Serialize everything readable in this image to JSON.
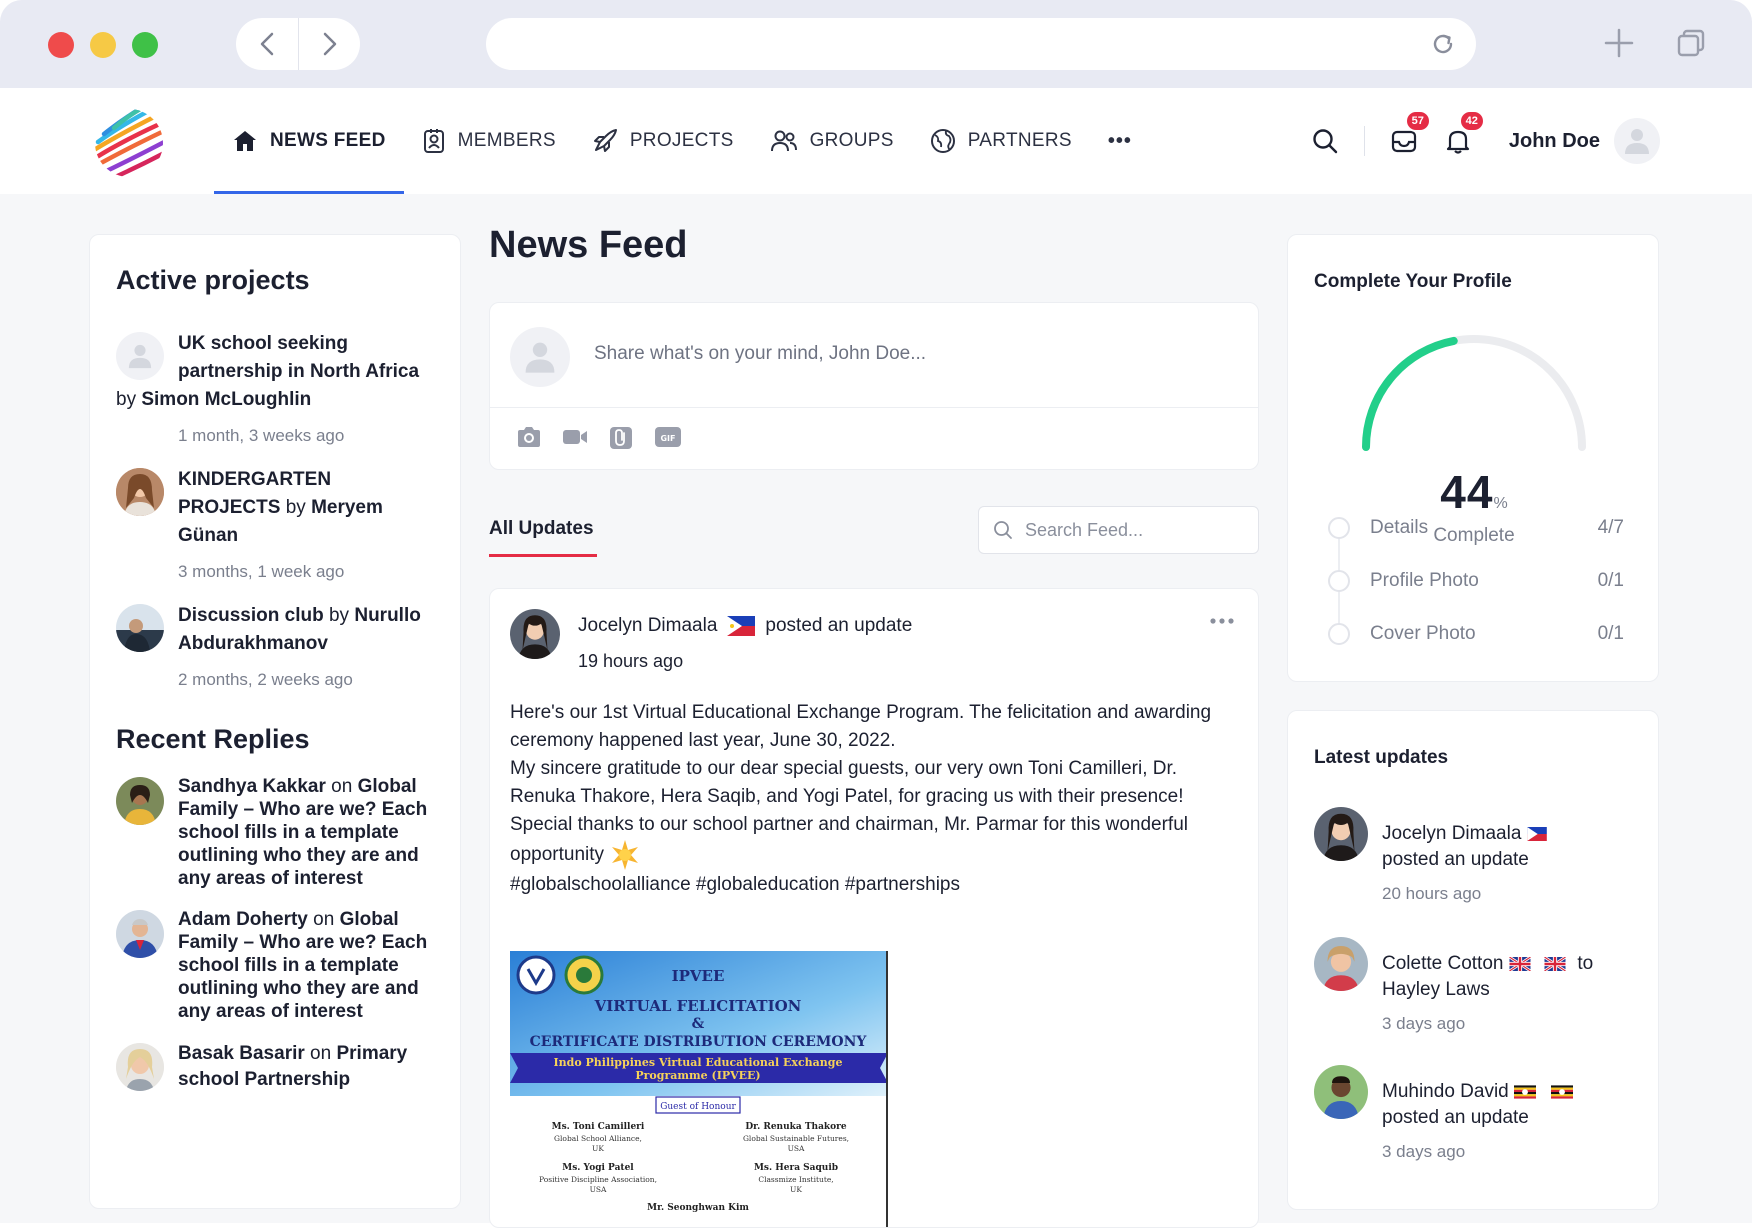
{
  "header": {
    "nav": [
      {
        "label": "NEWS FEED",
        "icon": "home-icon",
        "active": true
      },
      {
        "label": "MEMBERS",
        "icon": "members-icon"
      },
      {
        "label": "PROJECTS",
        "icon": "projects-icon"
      },
      {
        "label": "GROUPS",
        "icon": "groups-icon"
      },
      {
        "label": "PARTNERS",
        "icon": "partners-icon"
      }
    ],
    "more_label": "•••",
    "inbox_count": "57",
    "notifications_count": "42",
    "user_name": "John Doe"
  },
  "left": {
    "active_title": "Active projects",
    "projects": [
      {
        "title": "UK school seeking partnership in North Africa",
        "by": "by",
        "author": "Simon McLoughlin",
        "time": "1 month, 3 weeks ago"
      },
      {
        "title": "KINDERGARTEN PROJECTS",
        "by": "by",
        "author": "Meryem Günan",
        "time": "3 months, 1 week ago"
      },
      {
        "title": "Discussion club",
        "by": "by",
        "author": "Nurullo Abdurakhmanov",
        "time": "2 months, 2 weeks ago"
      }
    ],
    "replies_title": "Recent Replies",
    "replies": [
      {
        "author": "Sandhya Kakkar",
        "on": "on",
        "topic": "Global Family – Who are we? Each school fills in a template outlining who they are and any areas of interest"
      },
      {
        "author": "Adam Doherty",
        "on": "on",
        "topic": "Global Family – Who are we? Each school fills in a template outlining who they are and any areas of interest"
      },
      {
        "author": "Basak Basarir",
        "on": "on",
        "topic": "Primary school Partnership"
      }
    ]
  },
  "center": {
    "title": "News Feed",
    "composer_placeholder": "Share what's on your mind, John Doe...",
    "tab_all": "All Updates",
    "search_placeholder": "Search Feed...",
    "post": {
      "author": "Jocelyn Dimaala",
      "action": "posted an update",
      "time": "19 hours ago",
      "line1": "Here's our 1st Virtual Educational Exchange Program. The felicitation and awarding ceremony happened last year, June 30, 2022.",
      "line2": "My sincere gratitude to our dear special guests, our very own Toni Camilleri, Dr. Renuka Thakore, Hera Saqib, and Yogi Patel, for gracing us with their presence!",
      "line3": "Special thanks to our school partner and chairman, Mr. Parmar for this wonderful opportunity",
      "tags": "#globalschoolalliance #globaleducation #partnerships",
      "image": {
        "header": "IPVEE",
        "title1": "VIRTUAL FELICITATION",
        "amp": "&",
        "title2": "CERTIFICATE DISTRIBUTION CEREMONY",
        "banner1": "Indo Philippines Virtual Educational Exchange",
        "banner2": "Programme (IPVEE)",
        "guests_label": "Guest of Honour",
        "g1_name": "Ms. Toni Camilleri",
        "g1_org": "Global School Alliance,",
        "g1_country": "UK",
        "g2_name": "Dr. Renuka Thakore",
        "g2_org": "Global Sustainable Futures,",
        "g2_country": "USA",
        "g3_name": "Ms. Yogi Patel",
        "g3_org": "Positive Discipline Association,",
        "g3_country": "USA",
        "g4_name": "Ms. Hera Saquib",
        "g4_org": "Classmize Institute,",
        "g4_country": "UK",
        "g5_name": "Mr. Seonghwan Kim"
      }
    }
  },
  "right": {
    "profile_title": "Complete Your Profile",
    "percent": 44,
    "percent_text": "44",
    "percent_sign": "%",
    "complete_label": "Complete",
    "checklist": [
      {
        "label": "Details",
        "count": "4/7"
      },
      {
        "label": "Profile Photo",
        "count": "0/1"
      },
      {
        "label": "Cover Photo",
        "count": "0/1"
      }
    ],
    "latest_title": "Latest updates",
    "latest": [
      {
        "name": "Jocelyn Dimaala",
        "action": "posted an update",
        "time": "20 hours ago"
      },
      {
        "name": "Colette Cotton",
        "to": "to",
        "target": "Hayley Laws",
        "time": "3 days ago"
      },
      {
        "name": "Muhindo David",
        "action": "posted an update",
        "time": "3 days ago"
      }
    ]
  },
  "colors": {
    "accent": "#3466e8",
    "badge": "#e52c45",
    "gauge": "#22cf8a"
  }
}
